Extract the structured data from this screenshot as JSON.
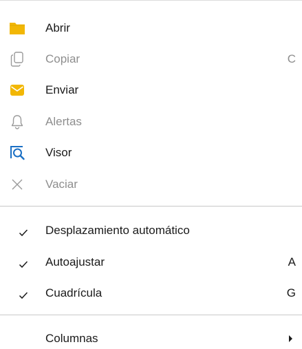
{
  "menu": {
    "items": [
      {
        "label": "Abrir",
        "shortcut": "",
        "icon": "folder-icon",
        "enabled": true
      },
      {
        "label": "Copiar",
        "shortcut": "C",
        "icon": "copy-icon",
        "enabled": false
      },
      {
        "label": "Enviar",
        "shortcut": "",
        "icon": "mail-icon",
        "enabled": true
      },
      {
        "label": "Alertas",
        "shortcut": "",
        "icon": "bell-icon",
        "enabled": false
      },
      {
        "label": "Visor",
        "shortcut": "",
        "icon": "magnifier-icon",
        "enabled": true
      },
      {
        "label": "Vaciar",
        "shortcut": "",
        "icon": "close-icon",
        "enabled": false
      }
    ],
    "toggles": [
      {
        "label": "Desplazamiento automático",
        "shortcut": "",
        "checked": true
      },
      {
        "label": "Autoajustar",
        "shortcut": "A",
        "checked": true
      },
      {
        "label": "Cuadrícula",
        "shortcut": "G",
        "checked": true
      }
    ],
    "submenu": {
      "label": "Columnas",
      "has_submenu": true
    }
  },
  "colors": {
    "folder": "#f2b705",
    "mail": "#f2b705",
    "accent": "#1a6fc4",
    "disabled": "#9a9a9a",
    "text": "#1a1a1a"
  }
}
